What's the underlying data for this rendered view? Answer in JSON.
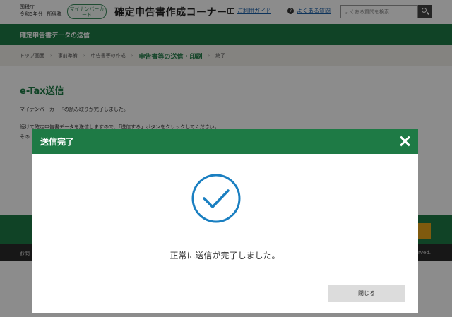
{
  "header": {
    "agency_name": "国税庁",
    "tax_year": "令和5年分",
    "tax_type": "所得税",
    "mynumber_badge": "マイナンバーカード",
    "corner_title": "確定申告書作成コーナー",
    "guide_link": "ご利用ガイド",
    "faq_link": "よくある質問",
    "search_placeholder": "よくある質問を検索"
  },
  "page_band": {
    "title": "確定申告書データの送信"
  },
  "breadcrumb": {
    "steps": [
      "トップ画面",
      "事前準備",
      "申告書等の作成",
      "申告書等の送信・印刷",
      "終了"
    ],
    "current_index": 3
  },
  "main": {
    "heading": "e-Tax送信",
    "line1": "マイナンバーカードの読み取りが完了しました。",
    "line2": "続けて確定申告書データを送信しますので、「送信する」ボタンをクリックしてください。",
    "line3": "その"
  },
  "footer": {
    "left_text": "お問",
    "right_text": "rved."
  },
  "modal": {
    "title": "送信完了",
    "message": "正常に送信が完了しました。",
    "close_button": "閉じる",
    "icon": "check-circle-icon"
  },
  "colors": {
    "brand_green": "#1e7a45",
    "check_blue": "#1a7fc1",
    "accent_orange": "#e8a51b"
  }
}
